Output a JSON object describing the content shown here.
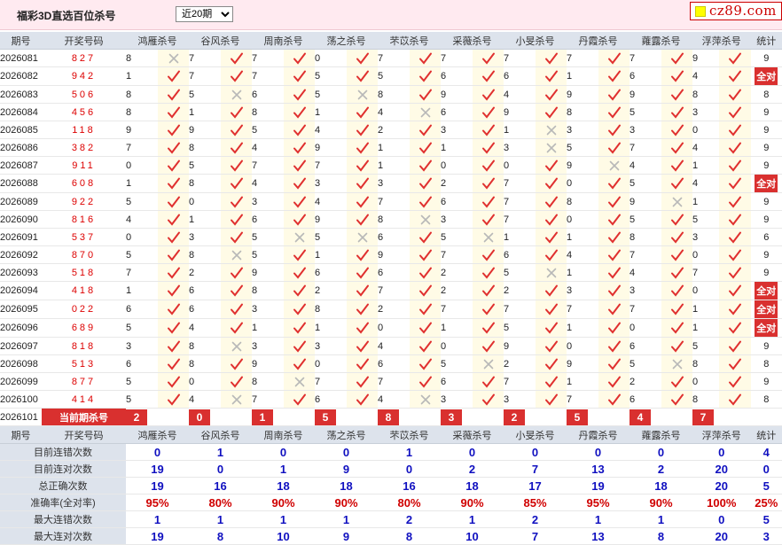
{
  "header": {
    "title": "福彩3D直选百位杀号",
    "period_select": "近20期",
    "period_options": [
      "近20期"
    ],
    "logo": "cz89.com"
  },
  "columns": [
    "期号",
    "开奖号码",
    "鸿雁杀号",
    "谷风杀号",
    "周南杀号",
    "荡之杀号",
    "芣苡杀号",
    "采薇杀号",
    "小旻杀号",
    "丹霞杀号",
    "蕹露杀号",
    "浮萍杀号",
    "统计"
  ],
  "rows": [
    {
      "period": "2026081",
      "draw": "827",
      "kills": [
        [
          "8",
          "x"
        ],
        [
          "7",
          "v"
        ],
        [
          "7",
          "v"
        ],
        [
          "0",
          "v"
        ],
        [
          "7",
          "v"
        ],
        [
          "7",
          "v"
        ],
        [
          "7",
          "v"
        ],
        [
          "7",
          "v"
        ],
        [
          "7",
          "v"
        ],
        [
          "9",
          "v"
        ]
      ],
      "stat": "9"
    },
    {
      "period": "2026082",
      "draw": "942",
      "kills": [
        [
          "1",
          "v"
        ],
        [
          "7",
          "v"
        ],
        [
          "7",
          "v"
        ],
        [
          "5",
          "v"
        ],
        [
          "5",
          "v"
        ],
        [
          "6",
          "v"
        ],
        [
          "6",
          "v"
        ],
        [
          "1",
          "v"
        ],
        [
          "6",
          "v"
        ],
        [
          "4",
          "v"
        ]
      ],
      "stat": "全对"
    },
    {
      "period": "2026083",
      "draw": "506",
      "kills": [
        [
          "8",
          "v"
        ],
        [
          "5",
          "x"
        ],
        [
          "6",
          "v"
        ],
        [
          "5",
          "x"
        ],
        [
          "8",
          "v"
        ],
        [
          "9",
          "v"
        ],
        [
          "4",
          "v"
        ],
        [
          "9",
          "v"
        ],
        [
          "9",
          "v"
        ],
        [
          "8",
          "v"
        ]
      ],
      "stat": "8"
    },
    {
      "period": "2026084",
      "draw": "456",
      "kills": [
        [
          "8",
          "v"
        ],
        [
          "1",
          "v"
        ],
        [
          "8",
          "v"
        ],
        [
          "1",
          "v"
        ],
        [
          "4",
          "x"
        ],
        [
          "6",
          "v"
        ],
        [
          "9",
          "v"
        ],
        [
          "8",
          "v"
        ],
        [
          "5",
          "v"
        ],
        [
          "3",
          "v"
        ]
      ],
      "stat": "9"
    },
    {
      "period": "2026085",
      "draw": "118",
      "kills": [
        [
          "9",
          "v"
        ],
        [
          "9",
          "v"
        ],
        [
          "5",
          "v"
        ],
        [
          "4",
          "v"
        ],
        [
          "2",
          "v"
        ],
        [
          "3",
          "v"
        ],
        [
          "1",
          "x"
        ],
        [
          "3",
          "v"
        ],
        [
          "3",
          "v"
        ],
        [
          "0",
          "v"
        ]
      ],
      "stat": "9"
    },
    {
      "period": "2026086",
      "draw": "382",
      "kills": [
        [
          "7",
          "v"
        ],
        [
          "8",
          "v"
        ],
        [
          "4",
          "v"
        ],
        [
          "9",
          "v"
        ],
        [
          "1",
          "v"
        ],
        [
          "1",
          "v"
        ],
        [
          "3",
          "x"
        ],
        [
          "5",
          "v"
        ],
        [
          "7",
          "v"
        ],
        [
          "4",
          "v"
        ]
      ],
      "stat": "9"
    },
    {
      "period": "2026087",
      "draw": "911",
      "kills": [
        [
          "0",
          "v"
        ],
        [
          "5",
          "v"
        ],
        [
          "7",
          "v"
        ],
        [
          "7",
          "v"
        ],
        [
          "1",
          "v"
        ],
        [
          "0",
          "v"
        ],
        [
          "0",
          "v"
        ],
        [
          "9",
          "x"
        ],
        [
          "4",
          "v"
        ],
        [
          "1",
          "v"
        ]
      ],
      "stat": "9"
    },
    {
      "period": "2026088",
      "draw": "608",
      "kills": [
        [
          "1",
          "v"
        ],
        [
          "8",
          "v"
        ],
        [
          "4",
          "v"
        ],
        [
          "3",
          "v"
        ],
        [
          "3",
          "v"
        ],
        [
          "2",
          "v"
        ],
        [
          "7",
          "v"
        ],
        [
          "0",
          "v"
        ],
        [
          "5",
          "v"
        ],
        [
          "4",
          "v"
        ]
      ],
      "stat": "全对"
    },
    {
      "period": "2026089",
      "draw": "922",
      "kills": [
        [
          "5",
          "v"
        ],
        [
          "0",
          "v"
        ],
        [
          "3",
          "v"
        ],
        [
          "4",
          "v"
        ],
        [
          "7",
          "v"
        ],
        [
          "6",
          "v"
        ],
        [
          "7",
          "v"
        ],
        [
          "8",
          "v"
        ],
        [
          "9",
          "x"
        ],
        [
          "1",
          "v"
        ]
      ],
      "stat": "9"
    },
    {
      "period": "2026090",
      "draw": "816",
      "kills": [
        [
          "4",
          "v"
        ],
        [
          "1",
          "v"
        ],
        [
          "6",
          "v"
        ],
        [
          "9",
          "v"
        ],
        [
          "8",
          "x"
        ],
        [
          "3",
          "v"
        ],
        [
          "7",
          "v"
        ],
        [
          "0",
          "v"
        ],
        [
          "5",
          "v"
        ],
        [
          "5",
          "v"
        ]
      ],
      "stat": "9"
    },
    {
      "period": "2026091",
      "draw": "537",
      "kills": [
        [
          "0",
          "v"
        ],
        [
          "3",
          "v"
        ],
        [
          "5",
          "x"
        ],
        [
          "5",
          "x"
        ],
        [
          "6",
          "v"
        ],
        [
          "5",
          "x"
        ],
        [
          "1",
          "v"
        ],
        [
          "1",
          "v"
        ],
        [
          "8",
          "v"
        ],
        [
          "3",
          "v"
        ]
      ],
      "stat": "6"
    },
    {
      "period": "2026092",
      "draw": "870",
      "kills": [
        [
          "5",
          "v"
        ],
        [
          "8",
          "x"
        ],
        [
          "5",
          "v"
        ],
        [
          "1",
          "v"
        ],
        [
          "9",
          "v"
        ],
        [
          "7",
          "v"
        ],
        [
          "6",
          "v"
        ],
        [
          "4",
          "v"
        ],
        [
          "7",
          "v"
        ],
        [
          "0",
          "v"
        ]
      ],
      "stat": "9"
    },
    {
      "period": "2026093",
      "draw": "518",
      "kills": [
        [
          "7",
          "v"
        ],
        [
          "2",
          "v"
        ],
        [
          "9",
          "v"
        ],
        [
          "6",
          "v"
        ],
        [
          "6",
          "v"
        ],
        [
          "2",
          "v"
        ],
        [
          "5",
          "x"
        ],
        [
          "1",
          "v"
        ],
        [
          "4",
          "v"
        ],
        [
          "7",
          "v"
        ]
      ],
      "stat": "9"
    },
    {
      "period": "2026094",
      "draw": "418",
      "kills": [
        [
          "1",
          "v"
        ],
        [
          "6",
          "v"
        ],
        [
          "8",
          "v"
        ],
        [
          "2",
          "v"
        ],
        [
          "7",
          "v"
        ],
        [
          "2",
          "v"
        ],
        [
          "2",
          "v"
        ],
        [
          "3",
          "v"
        ],
        [
          "3",
          "v"
        ],
        [
          "0",
          "v"
        ]
      ],
      "stat": "全对"
    },
    {
      "period": "2026095",
      "draw": "022",
      "kills": [
        [
          "6",
          "v"
        ],
        [
          "6",
          "v"
        ],
        [
          "3",
          "v"
        ],
        [
          "8",
          "v"
        ],
        [
          "2",
          "v"
        ],
        [
          "7",
          "v"
        ],
        [
          "7",
          "v"
        ],
        [
          "7",
          "v"
        ],
        [
          "7",
          "v"
        ],
        [
          "1",
          "v"
        ]
      ],
      "stat": "全对"
    },
    {
      "period": "2026096",
      "draw": "689",
      "kills": [
        [
          "5",
          "v"
        ],
        [
          "4",
          "v"
        ],
        [
          "1",
          "v"
        ],
        [
          "1",
          "v"
        ],
        [
          "0",
          "v"
        ],
        [
          "1",
          "v"
        ],
        [
          "5",
          "v"
        ],
        [
          "1",
          "v"
        ],
        [
          "0",
          "v"
        ],
        [
          "1",
          "v"
        ]
      ],
      "stat": "全对"
    },
    {
      "period": "2026097",
      "draw": "818",
      "kills": [
        [
          "3",
          "v"
        ],
        [
          "8",
          "x"
        ],
        [
          "3",
          "v"
        ],
        [
          "3",
          "v"
        ],
        [
          "4",
          "v"
        ],
        [
          "0",
          "v"
        ],
        [
          "9",
          "v"
        ],
        [
          "0",
          "v"
        ],
        [
          "6",
          "v"
        ],
        [
          "5",
          "v"
        ]
      ],
      "stat": "9"
    },
    {
      "period": "2026098",
      "draw": "513",
      "kills": [
        [
          "6",
          "v"
        ],
        [
          "8",
          "v"
        ],
        [
          "9",
          "v"
        ],
        [
          "0",
          "v"
        ],
        [
          "6",
          "v"
        ],
        [
          "5",
          "x"
        ],
        [
          "2",
          "v"
        ],
        [
          "9",
          "v"
        ],
        [
          "5",
          "x"
        ],
        [
          "8",
          "v"
        ]
      ],
      "stat": "8"
    },
    {
      "period": "2026099",
      "draw": "877",
      "kills": [
        [
          "5",
          "v"
        ],
        [
          "0",
          "v"
        ],
        [
          "8",
          "x"
        ],
        [
          "7",
          "v"
        ],
        [
          "7",
          "v"
        ],
        [
          "6",
          "v"
        ],
        [
          "7",
          "v"
        ],
        [
          "1",
          "v"
        ],
        [
          "2",
          "v"
        ],
        [
          "0",
          "v"
        ]
      ],
      "stat": "9"
    },
    {
      "period": "2026100",
      "draw": "414",
      "kills": [
        [
          "5",
          "v"
        ],
        [
          "4",
          "x"
        ],
        [
          "7",
          "v"
        ],
        [
          "6",
          "v"
        ],
        [
          "4",
          "x"
        ],
        [
          "3",
          "v"
        ],
        [
          "3",
          "v"
        ],
        [
          "7",
          "v"
        ],
        [
          "6",
          "v"
        ],
        [
          "8",
          "v"
        ]
      ],
      "stat": "8"
    }
  ],
  "current": {
    "period": "2026101",
    "label": "当前期杀号",
    "kills": [
      "2",
      "0",
      "1",
      "5",
      "8",
      "3",
      "2",
      "5",
      "4",
      "7"
    ]
  },
  "stats": [
    {
      "label": "目前连错次数",
      "color": "#1010c0",
      "values": [
        "0",
        "1",
        "0",
        "0",
        "1",
        "0",
        "0",
        "0",
        "0",
        "0",
        "4"
      ]
    },
    {
      "label": "目前连对次数",
      "color": "#1010c0",
      "values": [
        "19",
        "0",
        "1",
        "9",
        "0",
        "2",
        "7",
        "13",
        "2",
        "20",
        "0"
      ]
    },
    {
      "label": "总正确次数",
      "color": "#1010c0",
      "values": [
        "19",
        "16",
        "18",
        "18",
        "16",
        "18",
        "17",
        "19",
        "18",
        "20",
        "5"
      ]
    },
    {
      "label": "准确率(全对率)",
      "color": "#d00000",
      "values": [
        "95%",
        "80%",
        "90%",
        "90%",
        "80%",
        "90%",
        "85%",
        "95%",
        "90%",
        "100%",
        "25%"
      ]
    },
    {
      "label": "最大连错次数",
      "color": "#1010c0",
      "values": [
        "1",
        "1",
        "1",
        "1",
        "2",
        "1",
        "2",
        "1",
        "1",
        "0",
        "5"
      ]
    },
    {
      "label": "最大连对次数",
      "color": "#1010c0",
      "values": [
        "19",
        "8",
        "10",
        "9",
        "8",
        "10",
        "7",
        "13",
        "8",
        "20",
        "3"
      ]
    }
  ],
  "colors": {
    "accent": "#d9302f",
    "header_bg": "#dde3ec",
    "mark_bg": "#fffbe6",
    "stat_blue": "#1010c0"
  },
  "icons": {
    "v": "check-icon",
    "x": "cross-icon"
  }
}
